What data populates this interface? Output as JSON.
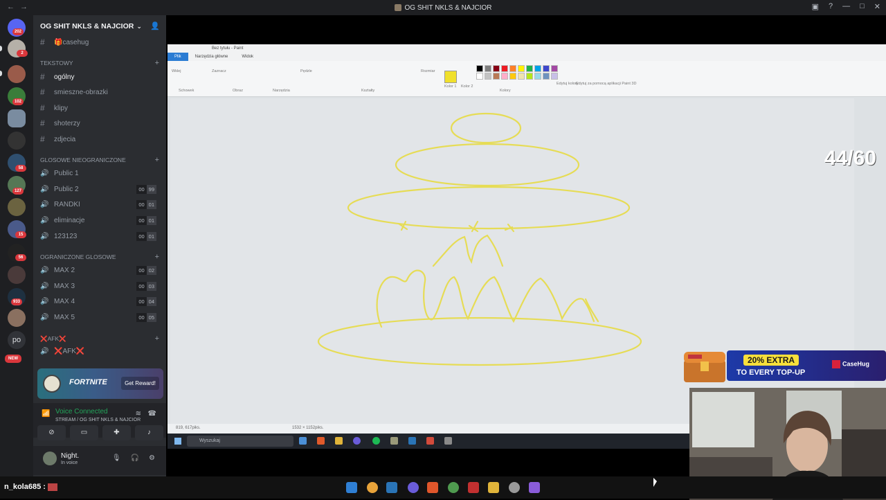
{
  "window": {
    "title": "OG SHIT NKLS & NAJCIOR"
  },
  "rail": {
    "badges": [
      "202",
      "2",
      "102",
      "58",
      "127",
      "15",
      "56",
      "933"
    ],
    "po_label": "po",
    "new_label": "NEW"
  },
  "server": {
    "name": "OG SHIT NKLS & NAJCIOR"
  },
  "channels": {
    "top": [
      {
        "name": "casehug",
        "emoji": "🎁"
      }
    ],
    "text_category": "TEKSTOWY",
    "text": [
      {
        "name": "ogólny"
      },
      {
        "name": "smieszne-obrazki"
      },
      {
        "name": "klipy"
      },
      {
        "name": "shoterzy"
      },
      {
        "name": "zdjecia"
      }
    ],
    "voice_unlimited_category": "GLOSOWE NIEOGRANICZONE",
    "voice_unlimited": [
      {
        "name": "Public 1",
        "a": "",
        "b": ""
      },
      {
        "name": "Public 2",
        "a": "00",
        "b": "99"
      },
      {
        "name": "RANDKI",
        "a": "00",
        "b": "01"
      },
      {
        "name": "eliminacje",
        "a": "00",
        "b": "01"
      },
      {
        "name": "123123",
        "a": "00",
        "b": "01"
      }
    ],
    "voice_limited_category": "OGRANICZONE GLOSOWE",
    "voice_limited": [
      {
        "name": "MAX 2",
        "a": "00",
        "b": "02"
      },
      {
        "name": "MAX 3",
        "a": "00",
        "b": "03"
      },
      {
        "name": "MAX 4",
        "a": "00",
        "b": "04"
      },
      {
        "name": "MAX 5",
        "a": "00",
        "b": "05"
      }
    ],
    "afk_category": "❌AFK❌",
    "afk": [
      {
        "name": "❌AFK❌"
      }
    ]
  },
  "promo": {
    "brand": "FORTNITE",
    "cta": "Get Reward!"
  },
  "voice": {
    "status": "Voice Connected",
    "channel": "STREAM / OG SHIT NKLS & NAJCIOR"
  },
  "user": {
    "name": "Night.",
    "status": "In voice"
  },
  "paint": {
    "title": "Bez tytułu - Paint",
    "tabs": [
      "Plik",
      "Narzędzia główne",
      "Widok"
    ],
    "groups": [
      "Schowek",
      "Obraz",
      "Narzędzia",
      "Kształty",
      "Kolory"
    ],
    "labels": [
      "Wklej",
      "Zaznacz",
      "Pędzle",
      "Rozmiar",
      "Kolor 1",
      "Kolor 2",
      "Edytuj kolory",
      "Edytuj za pomocą aplikacji Paint 3D"
    ],
    "status_pos": "819, 617piks.",
    "status_size": "1532 × 1152piks.",
    "search": "Wyszukaj",
    "palette": [
      "#000000",
      "#7f7f7f",
      "#880015",
      "#ed1c24",
      "#ff7f27",
      "#fff200",
      "#22b14c",
      "#00a2e8",
      "#3f48cc",
      "#a349a4",
      "#ffffff",
      "#c3c3c3",
      "#b97a57",
      "#ffaec9",
      "#ffc90e",
      "#efe4b0",
      "#b5e61d",
      "#99d9ea",
      "#7092be",
      "#c8bfe7"
    ]
  },
  "overlay": {
    "counter": "44/60"
  },
  "ad": {
    "line1": "20% EXTRA",
    "line2": "TO EVERY TOP-UP",
    "brand": "CaseHug"
  },
  "taskbar": {
    "chat_user": "n_kola685 :"
  }
}
